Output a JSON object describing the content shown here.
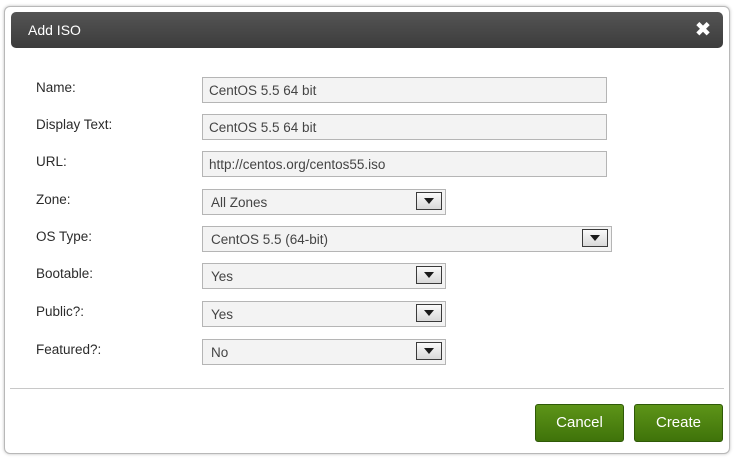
{
  "dialog": {
    "title": "Add ISO",
    "close_icon": "close-icon (×)"
  },
  "form": {
    "name": {
      "label": "Name:",
      "value": "CentOS 5.5 64 bit"
    },
    "display_text": {
      "label": "Display Text:",
      "value": "CentOS 5.5 64 bit"
    },
    "url": {
      "label": "URL:",
      "value": "http://centos.org/centos55.iso"
    },
    "zone": {
      "label": "Zone:",
      "selected": "All Zones"
    },
    "os_type": {
      "label": "OS Type:",
      "selected": "CentOS 5.5 (64-bit)"
    },
    "bootable": {
      "label": "Bootable:",
      "selected": "Yes"
    },
    "public": {
      "label": "Public?:",
      "selected": "Yes"
    },
    "featured": {
      "label": "Featured?:",
      "selected": "No"
    }
  },
  "buttons": {
    "cancel_label": "Cancel",
    "create_label": "Create"
  },
  "colors": {
    "titlebar": "#474747",
    "button_green": "#4e8411",
    "input_bg": "#f3f3f3"
  }
}
